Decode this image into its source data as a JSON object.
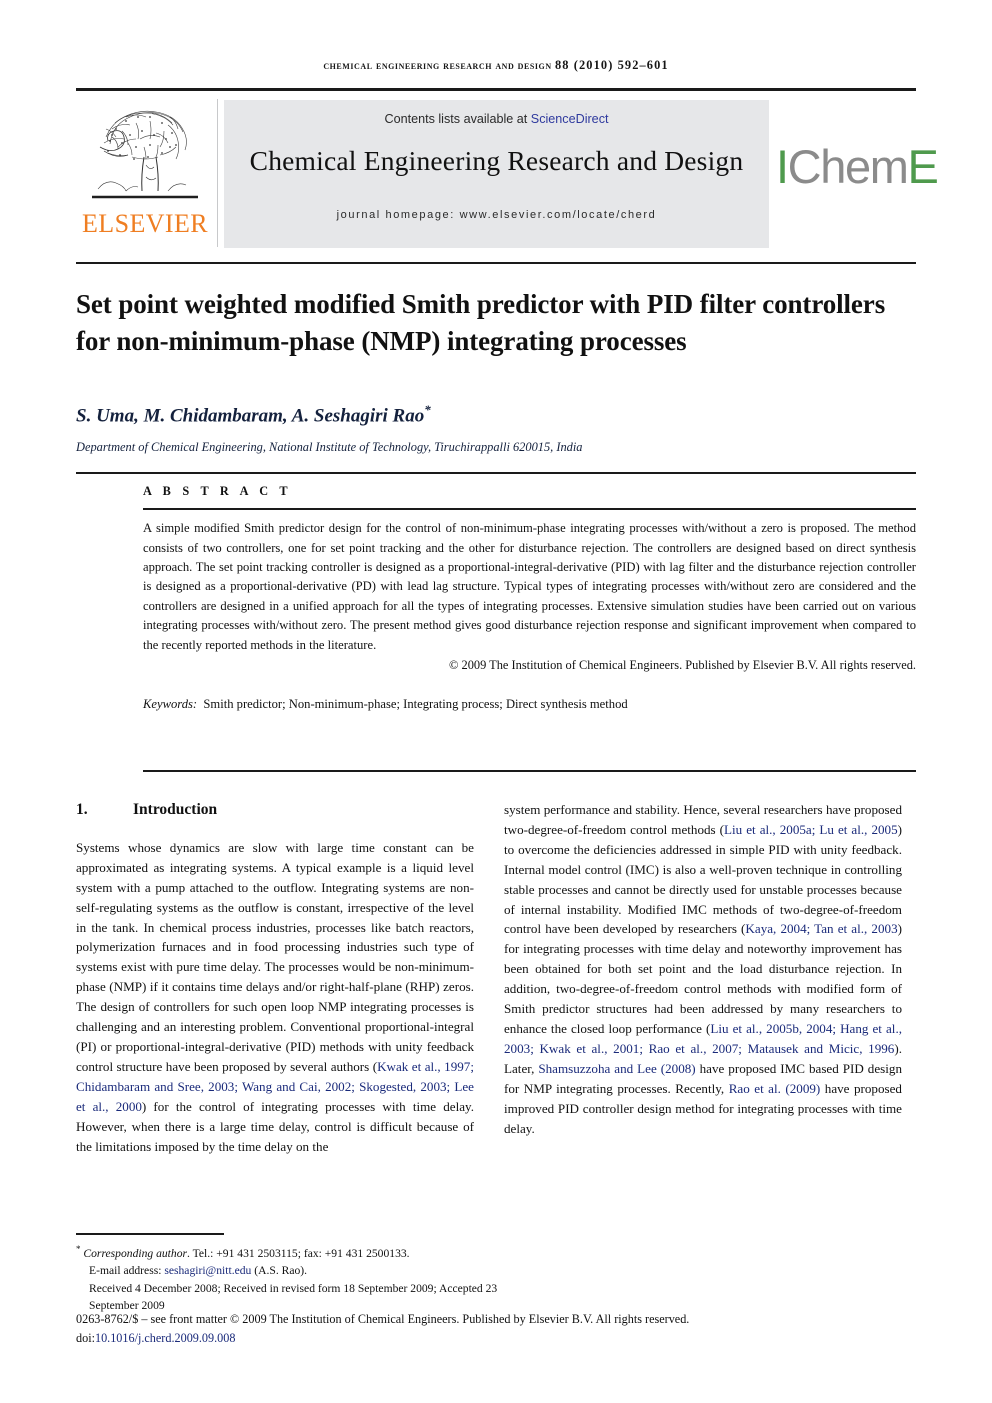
{
  "running_head": {
    "journal": "Chemical Engineering Research and Design",
    "volume_info": "88 (2010) 592–601"
  },
  "masthead": {
    "contents_prefix": "Contents lists available at ",
    "sciencedirect": "ScienceDirect",
    "journal_title": "Chemical Engineering Research and Design",
    "homepage": "journal homepage: www.elsevier.com/locate/cherd",
    "elsevier_wordmark": "ELSEVIER",
    "icheme": {
      "part1": "I",
      "part2": "Chem",
      "part3": "E"
    }
  },
  "article": {
    "title": "Set point weighted modified Smith predictor with PID filter controllers for non-minimum-phase (NMP) integrating processes",
    "authors": "S. Uma, M. Chidambaram, A. Seshagiri Rao",
    "corresponding_marker": "*",
    "affiliation": "Department of Chemical Engineering, National Institute of Technology, Tiruchirappalli 620015, India"
  },
  "abstract": {
    "label": "A B S T R A C T",
    "text": "A simple modified Smith predictor design for the control of non-minimum-phase integrating processes with/without a zero is proposed. The method consists of two controllers, one for set point tracking and the other for disturbance rejection. The controllers are designed based on direct synthesis approach. The set point tracking controller is designed as a proportional-integral-derivative (PID) with lag filter and the disturbance rejection controller is designed as a proportional-derivative (PD) with lead lag structure. Typical types of integrating processes with/without zero are considered and the controllers are designed in a unified approach for all the types of integrating processes. Extensive simulation studies have been carried out on various integrating processes with/without zero. The present method gives good disturbance rejection response and significant improvement when compared to the recently reported methods in the literature.",
    "copyright": "© 2009 The Institution of Chemical Engineers. Published by Elsevier B.V. All rights reserved.",
    "keywords_label": "Keywords:",
    "keywords_value": "Smith predictor; Non-minimum-phase; Integrating process; Direct synthesis method"
  },
  "introduction": {
    "number": "1.",
    "heading": "Introduction",
    "left_column": {
      "part1": "Systems whose dynamics are slow with large time constant can be approximated as integrating systems. A typical example is a liquid level system with a pump attached to the outflow. Integrating systems are non-self-regulating systems as the outflow is constant, irrespective of the level in the tank. In chemical process industries, processes like batch reactors, polymerization furnaces and in food processing industries such type of systems exist with pure time delay. The processes would be non-minimum-phase (NMP) if it contains time delays and/or right-half-plane (RHP) zeros. The design of controllers for such open loop NMP integrating processes is challenging and an interesting problem. Conventional proportional-integral (PI) or proportional-integral-derivative (PID) methods with unity feedback control structure have been proposed by several authors (",
      "cite1": "Kwak et al., 1997; Chidambaram and Sree, 2003; Wang and Cai, 2002; Skogested, 2003; Lee et al., 2000",
      "part2": ") for the control of integrating processes with time delay. However, when there is a large time delay, control is difficult because of the limitations imposed by the time delay on the"
    },
    "right_column": {
      "part1": "system performance and stability. Hence, several researchers have proposed two-degree-of-freedom control methods (",
      "cite1": "Liu et al., 2005a; Lu et al., 2005",
      "part2": ") to overcome the deficiencies addressed in simple PID with unity feedback. Internal model control (IMC) is also a well-proven technique in controlling stable processes and cannot be directly used for unstable processes because of internal instability. Modified IMC methods of two-degree-of-freedom control have been developed by researchers (",
      "cite2": "Kaya, 2004; Tan et al., 2003",
      "part3": ") for integrating processes with time delay and noteworthy improvement has been obtained for both set point and the load disturbance rejection. In addition, two-degree-of-freedom control methods with modified form of Smith predictor structures had been addressed by many researchers to enhance the closed loop performance (",
      "cite3": "Liu et al., 2005b, 2004; Hang et al., 2003; Kwak et al., 2001; Rao et al., 2007; Matausek and Micic, 1996",
      "part4": "). Later, ",
      "cite4": "Shamsuzzoha and Lee (2008)",
      "part5": " have proposed IMC based PID design for NMP integrating processes. Recently, ",
      "cite5": "Rao et al. (2009)",
      "part6": " have proposed improved PID controller design method for integrating processes with time delay."
    }
  },
  "footer": {
    "corresponding_label": "Corresponding author",
    "corresponding_contact": ". Tel.: +91 431 2503115; fax: +91 431 2500133.",
    "email_label": "E-mail address: ",
    "email": "seshagiri@nitt.edu",
    "email_suffix": " (A.S. Rao).",
    "dates": "Received 4 December 2008; Received in revised form 18 September 2009; Accepted 23 September 2009",
    "issn_line": "0263-8762/$ – see front matter © 2009 The Institution of Chemical Engineers. Published by Elsevier B.V. All rights reserved.",
    "doi_label": "doi:",
    "doi_value": "10.1016/j.cherd.2009.09.008"
  },
  "colors": {
    "accent_orange": "#ef7e22",
    "link_blue": "#2f3a9e",
    "cite_navy": "#1a2a7a",
    "icheme_green": "#4f9a4d",
    "band_grey": "#e6e7e9"
  }
}
